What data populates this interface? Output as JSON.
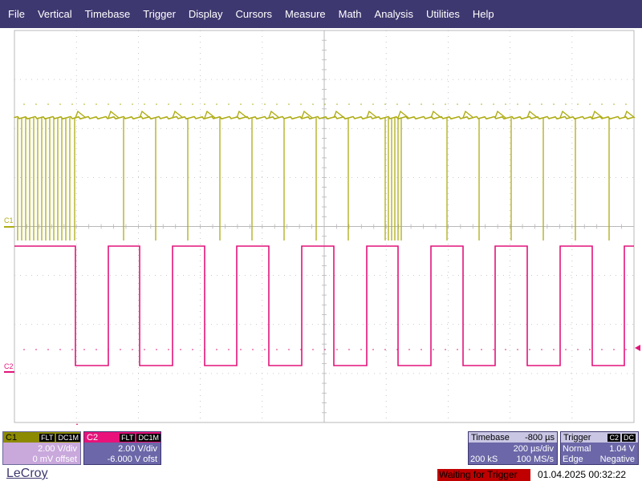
{
  "menu": [
    "File",
    "Vertical",
    "Timebase",
    "Trigger",
    "Display",
    "Cursors",
    "Measure",
    "Math",
    "Analysis",
    "Utilities",
    "Help"
  ],
  "colors": {
    "c1": "#aeac14",
    "c2": "#e2147a",
    "menubar": "#3e3870",
    "grid": "#b8b8b8"
  },
  "channels": {
    "c1": {
      "label": "C1",
      "flt": "FLT",
      "coupling": "DC1M",
      "vdiv": "2.00 V/div",
      "offset": "0 mV offset"
    },
    "c2": {
      "label": "C2",
      "flt": "FLT",
      "coupling": "DC1M",
      "vdiv": "2.00 V/div",
      "offset": "-6.000 V ofst"
    }
  },
  "timebase": {
    "title": "Timebase",
    "delay": "-800 µs",
    "tdiv": "200 µs/div",
    "samples": "200 kS",
    "rate": "100 MS/s"
  },
  "trigger": {
    "title": "Trigger",
    "source": "C2",
    "coupling": "DC",
    "mode": "Normal",
    "level": "1.04 V",
    "type": "Edge",
    "slope": "Negative"
  },
  "status": "Waiting for Trigger",
  "datetime": "01.04.2025 00:32:22",
  "brand": "LeCroy",
  "trace_labels": {
    "c1": "C1",
    "c2": "C2"
  },
  "c2_edges": [
    94,
    135,
    174,
    215,
    255,
    295,
    335,
    376,
    416,
    457,
    496,
    537,
    577,
    617,
    657,
    698,
    738,
    778
  ],
  "c1_spikes": [
    22,
    27,
    32,
    37,
    42,
    47,
    52,
    57,
    62,
    67,
    72,
    77,
    82,
    87,
    93,
    154,
    194,
    234,
    274,
    314,
    354,
    394,
    434,
    480,
    484,
    488,
    492,
    496,
    500,
    557,
    597,
    637,
    677,
    717,
    759
  ]
}
